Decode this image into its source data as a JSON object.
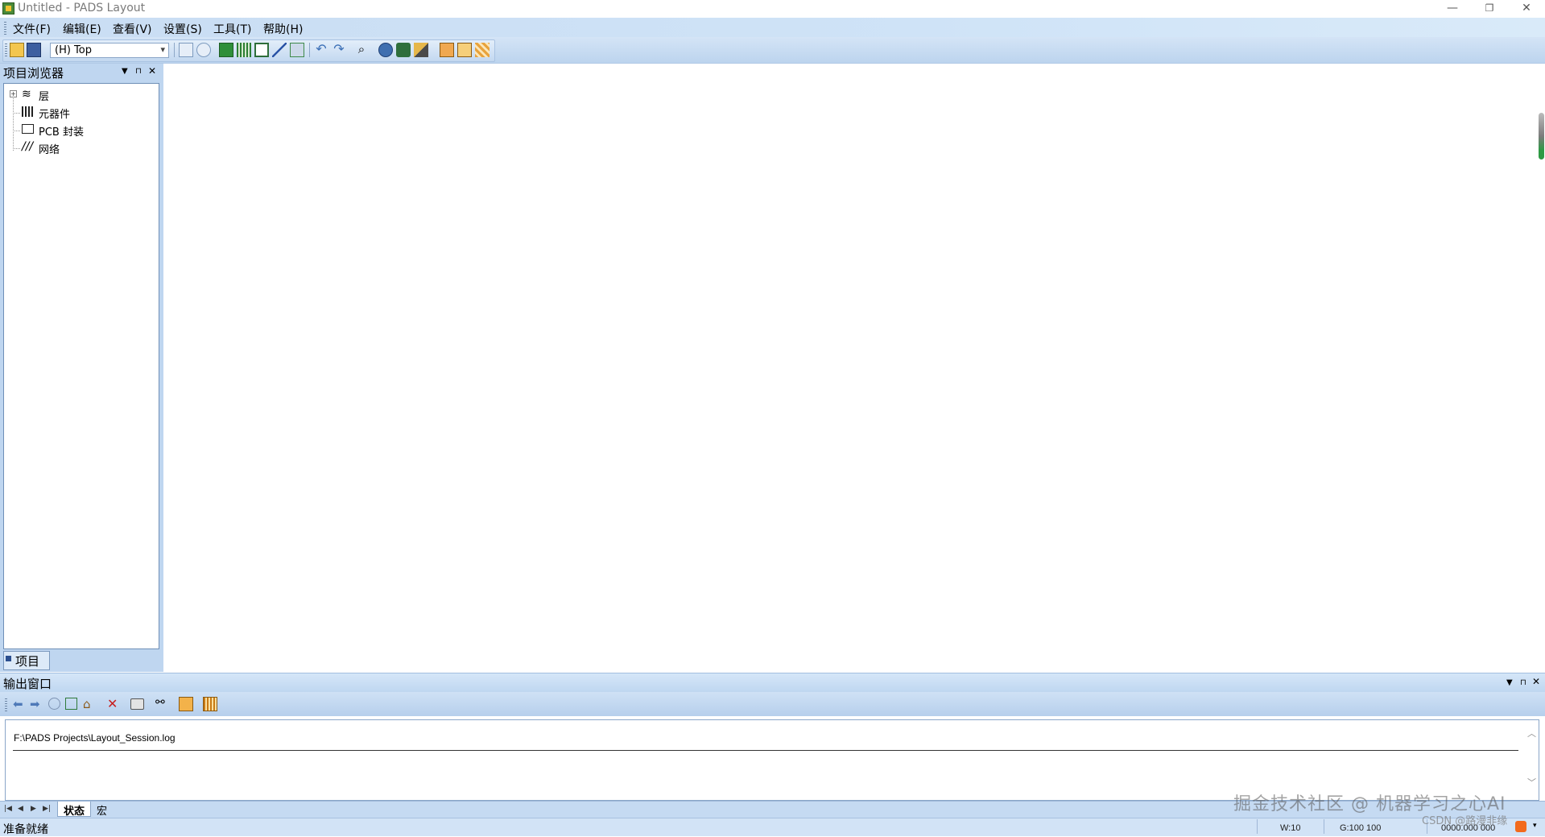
{
  "window": {
    "title": "Untitled - PADS Layout",
    "controls": {
      "minimize": "—",
      "restore": "❐",
      "close": "✕"
    }
  },
  "menu": {
    "items": [
      "文件(F)",
      "编辑(E)",
      "查看(V)",
      "设置(S)",
      "工具(T)",
      "帮助(H)"
    ]
  },
  "toolbar": {
    "layer_select": "(H) Top"
  },
  "project_browser": {
    "title": "项目浏览器",
    "tree": [
      {
        "label": "层",
        "icon": "layers-icon",
        "expandable": true
      },
      {
        "label": "元器件",
        "icon": "components-icon"
      },
      {
        "label": "PCB 封装",
        "icon": "pcb-decal-icon"
      },
      {
        "label": "网络",
        "icon": "nets-icon"
      }
    ],
    "tab": "项目"
  },
  "output_window": {
    "title": "输出窗口",
    "log_path": "F:\\PADS Projects\\Layout_Session.log",
    "tabs": [
      "状态",
      "宏"
    ]
  },
  "status_bar": {
    "ready": "准备就绪",
    "width": "W:10",
    "grid": "G:100 100",
    "coords": "0000.000 000"
  },
  "watermark": {
    "line1": "掘金技术社区 @ 机器学习之心AI",
    "line2": "CSDN @路漫非缘"
  },
  "colors": {
    "chrome": "#bfd6f0",
    "canvas": "#ffffff"
  }
}
